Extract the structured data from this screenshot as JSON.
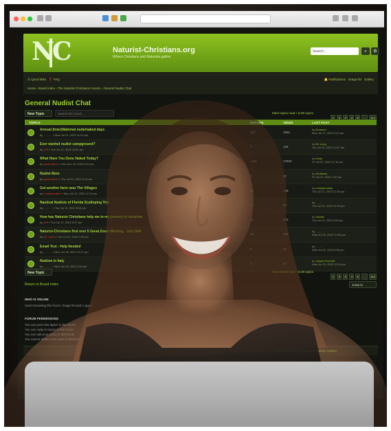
{
  "site": {
    "name": "Naturist-Christians.org",
    "tagline": "Where Christians and Naturists gather",
    "search_placeholder": "Search…"
  },
  "nav": {
    "quick_links": "Quick links",
    "faq": "FAQ",
    "breadcrumb": "Home  ›  Board index  ›  The Naturist-Christians Forums  ›  General Nudist Chat",
    "notifications": "Notifications",
    "user": "Image list",
    "gallery": "Gallery"
  },
  "forum": {
    "title": "General Nudist Chat",
    "new_topic": "New Topic",
    "search_placeholder": "Search this forum…",
    "mark_read": "Mark topics read • 1135 topics",
    "pages": [
      "1",
      "2",
      "3",
      "4",
      "5",
      "…",
      "114"
    ],
    "columns": {
      "topics": "TOPICS",
      "replies": "REPLIES",
      "views": "VIEWS",
      "last_post": "LAST POST"
    }
  },
  "topics": [
    {
      "title": "Annual (Inter)National nude/naked days",
      "by": "by",
      "author": "...........",
      "date": "» Mon Jul 01, 2022 11:20 am",
      "replies": "112",
      "views": "2351",
      "last_by": "by",
      "last_user": "Dreamer",
      "last_date": "Mon Jul 17, 2022 3:10 pm",
      "last_red": false
    },
    {
      "title": "Ever wanted nudist campground?",
      "by": "by",
      "author": "Jeff",
      "date": "» Tue Jul 12, 2022 10:51 pm",
      "replies": "7",
      "views": "134",
      "last_by": "by",
      "last_user": "Mr. Larry",
      "last_date": "Tue Jul 12, 2022 11:57 am",
      "last_red": false
    },
    {
      "title": "What Have You Done Naked Today?",
      "by": "by",
      "author": "gardenfresh",
      "date": "» Sun Nov 15, 2015 6:41 pm",
      "replies": "1421",
      "views": "17632",
      "last_by": "by",
      "last_user": "Emily",
      "last_date": "Fri Jul 22, 2022 11:15 am",
      "last_red": false
    },
    {
      "title": "Nudist Mom",
      "by": "by",
      "author": "gardenlover",
      "date": "» Thu Jul 21, 2022 3:14 am",
      "replies": "3",
      "views": "67",
      "last_by": "by",
      "last_user": "Jimflower",
      "last_date": "Fri Jul 22, 2022 7:00 am",
      "last_red": false
    },
    {
      "title": "Got another farm near The Villages",
      "by": "by",
      "author": "mindybumbler",
      "date": "» Mon Jul 11, 2022 12:10 am",
      "replies": "13",
      "views": "196",
      "last_by": "by",
      "last_user": "mindybumbler",
      "last_date": "Thu Jul 21, 2022 11:48 pm",
      "last_red": false
    },
    {
      "title": "Nautical Nudists of Florida Scalloping Trip",
      "by": "by",
      "author": "...........",
      "date": "» Tue Jul 19, 2022 8:04 pm",
      "replies": "6",
      "views": "82",
      "last_by": "by",
      "last_user": "...........",
      "last_date": "Thu Jul 21, 2022 10:40 pm",
      "last_red": true
    },
    {
      "title": "How has Naturist Christians help me in my journey to naturism",
      "by": "by",
      "author": "Jeff",
      "date": "» Tue Jul 12, 2022 6:37 am",
      "replies": "11",
      "views": "201",
      "last_by": "by",
      "last_user": "Sheffer",
      "last_date": "Thu Jul 21, 2022 8:09 pm",
      "last_red": false
    },
    {
      "title": "Naturist-Christians first ever 5 Great Zoom Meeting - July 16th",
      "by": "by",
      "author": "Mr. Larry",
      "date": "» Tue Jul 07, 2022 1:29 pm",
      "replies": "26",
      "views": "466",
      "last_by": "by",
      "last_user": "...........",
      "last_date": "Wed Jul 20, 2022 10:30 pm",
      "last_red": true
    },
    {
      "title": "Email Test - Help Needed",
      "by": "by",
      "author": "...........",
      "date": "» Mon Jul 18, 2022 10:17 pm",
      "replies": "5",
      "views": "67",
      "last_by": "by",
      "last_user": "...........",
      "last_date": "Wed Jul 20, 2022 6:56 pm",
      "last_red": true
    },
    {
      "title": "Nudism in Italy",
      "by": "by",
      "author": "...........",
      "date": "» Mon Jul 18, 2022 2:03 pm",
      "replies": "3",
      "views": "57",
      "last_by": "by",
      "last_user": "Jaspen Emmett",
      "last_date": "Wed Jul 20, 2022 12:15 pm",
      "last_red": false
    }
  ],
  "bottom": {
    "return": "Return to Board Index",
    "jump": "Jump to",
    "who_heading": "WHO IS ONLINE",
    "who_text": "Users browsing this forum: Image list and 1 guest",
    "perm_heading": "FORUM PERMISSIONS",
    "perms": [
      "You can post new topics in this forum",
      "You can reply to topics in this forum",
      "You can edit your posts in this forum",
      "You cannot delete your posts in this forum"
    ],
    "footer_links": "Contact us   The team   Members   Delete cookies"
  },
  "colors": {
    "brand_green": "#7fb51a",
    "link_red": "#e03a2a",
    "laptop": "#b5b5b5"
  }
}
